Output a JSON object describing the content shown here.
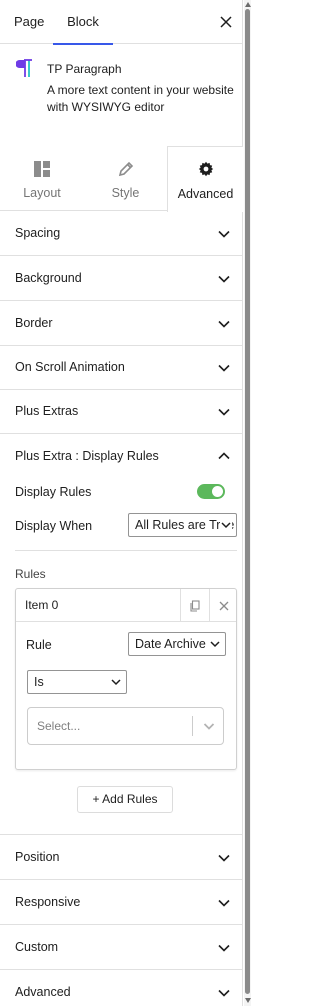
{
  "header": {
    "tab_page": "Page",
    "tab_block": "Block"
  },
  "block": {
    "title": "TP Paragraph",
    "description": "A more text content in your website with WYSIWYG editor",
    "icon_color": "#6f3ce6"
  },
  "style_tabs": [
    {
      "label": "Layout",
      "icon": "layout-grid-icon"
    },
    {
      "label": "Style",
      "icon": "pencil-icon"
    },
    {
      "label": "Advanced",
      "icon": "gear-icon",
      "active": true
    }
  ],
  "sections_top": [
    "Spacing",
    "Background",
    "Border",
    "On Scroll Animation",
    "Plus Extras"
  ],
  "display_rules": {
    "title": "Plus Extra : Display Rules",
    "display_rules_label": "Display Rules",
    "toggle_on": true,
    "toggle_color": "#5cb85c",
    "display_when_label": "Display When",
    "display_when_value": "All Rules are True",
    "rules_label": "Rules",
    "item": {
      "title": "Item 0",
      "rule_label": "Rule",
      "rule_value": "Date Archive",
      "operator_value": "Is",
      "value_placeholder": "Select..."
    },
    "add_button": "+ Add Rules"
  },
  "sections_bottom": [
    "Position",
    "Responsive",
    "Custom",
    "Advanced"
  ]
}
